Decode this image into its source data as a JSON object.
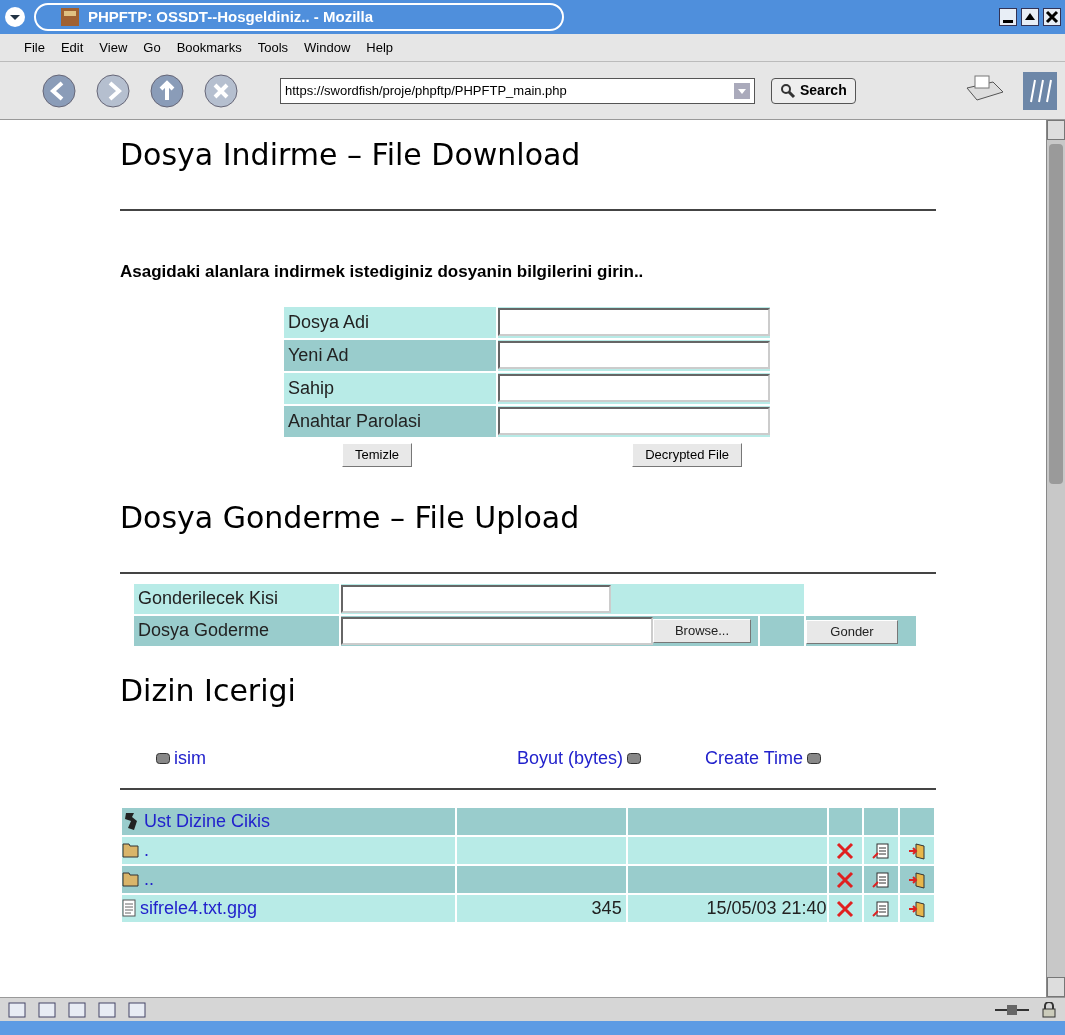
{
  "window": {
    "title": "PHPFTP: OSSDT--Hosgeldiniz.. - Mozilla"
  },
  "menu": [
    "File",
    "Edit",
    "View",
    "Go",
    "Bookmarks",
    "Tools",
    "Window",
    "Help"
  ],
  "toolbar": {
    "url": "https://swordfish/proje/phpftp/PHPFTP_main.php",
    "search_label": "Search"
  },
  "download": {
    "heading": "Dosya Indirme – File Download",
    "instruction": "Asagidaki alanlara indirmek istediginiz dosyanin bilgilerini girin..",
    "fields": [
      {
        "label": "Dosya Adi"
      },
      {
        "label": "Yeni Ad"
      },
      {
        "label": "Sahip"
      },
      {
        "label": "Anahtar Parolasi"
      }
    ],
    "buttons": [
      "Temizle",
      "Decrypted File"
    ]
  },
  "upload": {
    "heading": "Dosya Gonderme – File Upload",
    "recipient_label": "Gonderilecek Kisi",
    "file_label": "Dosya Goderme",
    "browse_label": "Browse...",
    "send_label": "Gonder"
  },
  "listing": {
    "heading": "Dizin Icerigi",
    "columns": [
      "isim",
      "Boyut (bytes)",
      "Create Time"
    ],
    "rows": [
      {
        "kind": "up",
        "name": "Ust Dizine Cikis"
      },
      {
        "kind": "folder",
        "name": "."
      },
      {
        "kind": "folder",
        "name": ".."
      },
      {
        "kind": "file",
        "name": "sifrele4.txt.gpg",
        "size": "345",
        "time": "15/05/03 21:40"
      }
    ]
  }
}
